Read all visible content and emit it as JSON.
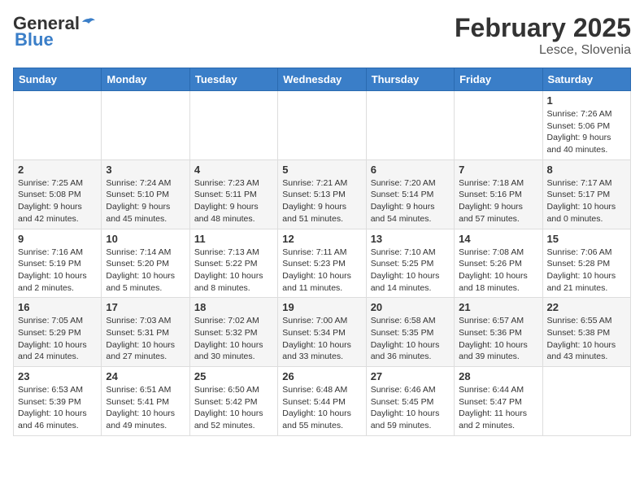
{
  "header": {
    "logo_general": "General",
    "logo_blue": "Blue",
    "month": "February 2025",
    "location": "Lesce, Slovenia"
  },
  "weekdays": [
    "Sunday",
    "Monday",
    "Tuesday",
    "Wednesday",
    "Thursday",
    "Friday",
    "Saturday"
  ],
  "weeks": [
    [
      {
        "day": "",
        "info": ""
      },
      {
        "day": "",
        "info": ""
      },
      {
        "day": "",
        "info": ""
      },
      {
        "day": "",
        "info": ""
      },
      {
        "day": "",
        "info": ""
      },
      {
        "day": "",
        "info": ""
      },
      {
        "day": "1",
        "info": "Sunrise: 7:26 AM\nSunset: 5:06 PM\nDaylight: 9 hours and 40 minutes."
      }
    ],
    [
      {
        "day": "2",
        "info": "Sunrise: 7:25 AM\nSunset: 5:08 PM\nDaylight: 9 hours and 42 minutes."
      },
      {
        "day": "3",
        "info": "Sunrise: 7:24 AM\nSunset: 5:10 PM\nDaylight: 9 hours and 45 minutes."
      },
      {
        "day": "4",
        "info": "Sunrise: 7:23 AM\nSunset: 5:11 PM\nDaylight: 9 hours and 48 minutes."
      },
      {
        "day": "5",
        "info": "Sunrise: 7:21 AM\nSunset: 5:13 PM\nDaylight: 9 hours and 51 minutes."
      },
      {
        "day": "6",
        "info": "Sunrise: 7:20 AM\nSunset: 5:14 PM\nDaylight: 9 hours and 54 minutes."
      },
      {
        "day": "7",
        "info": "Sunrise: 7:18 AM\nSunset: 5:16 PM\nDaylight: 9 hours and 57 minutes."
      },
      {
        "day": "8",
        "info": "Sunrise: 7:17 AM\nSunset: 5:17 PM\nDaylight: 10 hours and 0 minutes."
      }
    ],
    [
      {
        "day": "9",
        "info": "Sunrise: 7:16 AM\nSunset: 5:19 PM\nDaylight: 10 hours and 2 minutes."
      },
      {
        "day": "10",
        "info": "Sunrise: 7:14 AM\nSunset: 5:20 PM\nDaylight: 10 hours and 5 minutes."
      },
      {
        "day": "11",
        "info": "Sunrise: 7:13 AM\nSunset: 5:22 PM\nDaylight: 10 hours and 8 minutes."
      },
      {
        "day": "12",
        "info": "Sunrise: 7:11 AM\nSunset: 5:23 PM\nDaylight: 10 hours and 11 minutes."
      },
      {
        "day": "13",
        "info": "Sunrise: 7:10 AM\nSunset: 5:25 PM\nDaylight: 10 hours and 14 minutes."
      },
      {
        "day": "14",
        "info": "Sunrise: 7:08 AM\nSunset: 5:26 PM\nDaylight: 10 hours and 18 minutes."
      },
      {
        "day": "15",
        "info": "Sunrise: 7:06 AM\nSunset: 5:28 PM\nDaylight: 10 hours and 21 minutes."
      }
    ],
    [
      {
        "day": "16",
        "info": "Sunrise: 7:05 AM\nSunset: 5:29 PM\nDaylight: 10 hours and 24 minutes."
      },
      {
        "day": "17",
        "info": "Sunrise: 7:03 AM\nSunset: 5:31 PM\nDaylight: 10 hours and 27 minutes."
      },
      {
        "day": "18",
        "info": "Sunrise: 7:02 AM\nSunset: 5:32 PM\nDaylight: 10 hours and 30 minutes."
      },
      {
        "day": "19",
        "info": "Sunrise: 7:00 AM\nSunset: 5:34 PM\nDaylight: 10 hours and 33 minutes."
      },
      {
        "day": "20",
        "info": "Sunrise: 6:58 AM\nSunset: 5:35 PM\nDaylight: 10 hours and 36 minutes."
      },
      {
        "day": "21",
        "info": "Sunrise: 6:57 AM\nSunset: 5:36 PM\nDaylight: 10 hours and 39 minutes."
      },
      {
        "day": "22",
        "info": "Sunrise: 6:55 AM\nSunset: 5:38 PM\nDaylight: 10 hours and 43 minutes."
      }
    ],
    [
      {
        "day": "23",
        "info": "Sunrise: 6:53 AM\nSunset: 5:39 PM\nDaylight: 10 hours and 46 minutes."
      },
      {
        "day": "24",
        "info": "Sunrise: 6:51 AM\nSunset: 5:41 PM\nDaylight: 10 hours and 49 minutes."
      },
      {
        "day": "25",
        "info": "Sunrise: 6:50 AM\nSunset: 5:42 PM\nDaylight: 10 hours and 52 minutes."
      },
      {
        "day": "26",
        "info": "Sunrise: 6:48 AM\nSunset: 5:44 PM\nDaylight: 10 hours and 55 minutes."
      },
      {
        "day": "27",
        "info": "Sunrise: 6:46 AM\nSunset: 5:45 PM\nDaylight: 10 hours and 59 minutes."
      },
      {
        "day": "28",
        "info": "Sunrise: 6:44 AM\nSunset: 5:47 PM\nDaylight: 11 hours and 2 minutes."
      },
      {
        "day": "",
        "info": ""
      }
    ]
  ]
}
